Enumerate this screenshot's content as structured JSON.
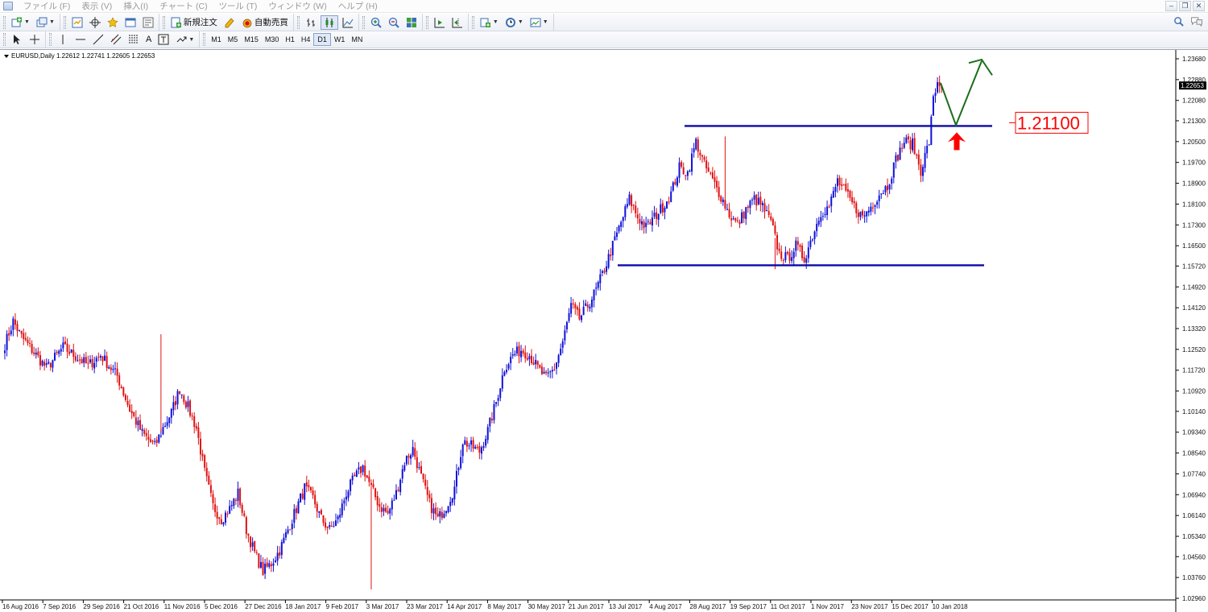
{
  "menubar": {
    "items": [
      "ファイル (F)",
      "表示 (V)",
      "挿入(I)",
      "チャート (C)",
      "ツール (T)",
      "ウィンドウ (W)",
      "ヘルプ (H)"
    ]
  },
  "toolbar": {
    "new_order": "新規注文",
    "auto_trade": "自動売買",
    "timeframes": [
      "M1",
      "M5",
      "M15",
      "M30",
      "H1",
      "H4",
      "D1",
      "W1",
      "MN"
    ],
    "active_timeframe": "D1",
    "text_tool": "A"
  },
  "chart": {
    "title": "EURUSD,Daily  1.22612 1.22741 1.22605 1.22653",
    "current_price_label": "1.22653",
    "level_label": "1.21100"
  },
  "chart_data": {
    "type": "candlestick",
    "symbol": "EURUSD",
    "timeframe": "Daily",
    "ohlc_header": {
      "open": 1.22612,
      "high": 1.22741,
      "low": 1.22605,
      "close": 1.22653
    },
    "y_ticks": [
      1.2368,
      1.2288,
      1.2208,
      1.213,
      1.205,
      1.197,
      1.189,
      1.181,
      1.173,
      1.165,
      1.1572,
      1.1492,
      1.1412,
      1.1332,
      1.1252,
      1.1172,
      1.1092,
      1.1014,
      1.0934,
      1.0854,
      1.0774,
      1.0694,
      1.0614,
      1.0534,
      1.0456,
      1.0376,
      1.0296
    ],
    "ylim": [
      1.0296,
      1.2368
    ],
    "x_tick_labels": [
      "16 Aug 2016",
      "7 Sep 2016",
      "29 Sep 2016",
      "21 Oct 2016",
      "11 Nov 2016",
      "5 Dec 2016",
      "27 Dec 2016",
      "18 Jan 2017",
      "9 Feb 2017",
      "3 Mar 2017",
      "23 Mar 2017",
      "14 Apr 2017",
      "8 May 2017",
      "30 May 2017",
      "21 Jun 2017",
      "13 Jul 2017",
      "4 Aug 2017",
      "28 Aug 2017",
      "19 Sep 2017",
      "11 Oct 2017",
      "1 Nov 2017",
      "23 Nov 2017",
      "15 Dec 2017",
      "10 Jan 2018"
    ],
    "price_path": [
      [
        0,
        1.127
      ],
      [
        4,
        1.136
      ],
      [
        8,
        1.13
      ],
      [
        14,
        1.124
      ],
      [
        20,
        1.118
      ],
      [
        28,
        1.126
      ],
      [
        40,
        1.119
      ],
      [
        46,
        1.123
      ],
      [
        54,
        1.115
      ],
      [
        60,
        1.102
      ],
      [
        66,
        1.093
      ],
      [
        72,
        1.088
      ],
      [
        76,
        1.095
      ],
      [
        80,
        1.101
      ],
      [
        84,
        1.11
      ],
      [
        88,
        1.103
      ],
      [
        92,
        1.095
      ],
      [
        96,
        1.078
      ],
      [
        100,
        1.065
      ],
      [
        104,
        1.06
      ],
      [
        108,
        1.064
      ],
      [
        112,
        1.07
      ],
      [
        116,
        1.056
      ],
      [
        120,
        1.047
      ],
      [
        124,
        1.04
      ],
      [
        128,
        1.043
      ],
      [
        132,
        1.048
      ],
      [
        136,
        1.056
      ],
      [
        140,
        1.064
      ],
      [
        144,
        1.072
      ],
      [
        148,
        1.068
      ],
      [
        152,
        1.06
      ],
      [
        156,
        1.056
      ],
      [
        160,
        1.06
      ],
      [
        164,
        1.07
      ],
      [
        168,
        1.076
      ],
      [
        172,
        1.08
      ],
      [
        176,
        1.072
      ],
      [
        180,
        1.065
      ],
      [
        184,
        1.062
      ],
      [
        188,
        1.07
      ],
      [
        192,
        1.082
      ],
      [
        196,
        1.087
      ],
      [
        200,
        1.076
      ],
      [
        204,
        1.066
      ],
      [
        208,
        1.06
      ],
      [
        212,
        1.065
      ],
      [
        216,
        1.072
      ],
      [
        220,
        1.09
      ],
      [
        224,
        1.088
      ],
      [
        228,
        1.086
      ],
      [
        232,
        1.094
      ],
      [
        236,
        1.105
      ],
      [
        240,
        1.118
      ],
      [
        244,
        1.123
      ],
      [
        248,
        1.125
      ],
      [
        252,
        1.123
      ],
      [
        256,
        1.118
      ],
      [
        260,
        1.114
      ],
      [
        264,
        1.118
      ],
      [
        268,
        1.128
      ],
      [
        272,
        1.142
      ],
      [
        276,
        1.137
      ],
      [
        280,
        1.142
      ],
      [
        284,
        1.148
      ],
      [
        288,
        1.156
      ],
      [
        292,
        1.165
      ],
      [
        296,
        1.174
      ],
      [
        300,
        1.183
      ],
      [
        304,
        1.176
      ],
      [
        308,
        1.172
      ],
      [
        312,
        1.176
      ],
      [
        316,
        1.18
      ],
      [
        320,
        1.185
      ],
      [
        324,
        1.195
      ],
      [
        328,
        1.193
      ],
      [
        332,
        1.205
      ],
      [
        336,
        1.196
      ],
      [
        340,
        1.19
      ],
      [
        344,
        1.184
      ],
      [
        348,
        1.177
      ],
      [
        352,
        1.173
      ],
      [
        356,
        1.179
      ],
      [
        360,
        1.183
      ],
      [
        364,
        1.18
      ],
      [
        368,
        1.174
      ],
      [
        372,
        1.162
      ],
      [
        376,
        1.16
      ],
      [
        380,
        1.165
      ],
      [
        384,
        1.16
      ],
      [
        388,
        1.169
      ],
      [
        392,
        1.178
      ],
      [
        396,
        1.18
      ],
      [
        400,
        1.19
      ],
      [
        404,
        1.185
      ],
      [
        408,
        1.18
      ],
      [
        412,
        1.176
      ],
      [
        416,
        1.18
      ],
      [
        420,
        1.185
      ],
      [
        424,
        1.188
      ],
      [
        428,
        1.198
      ],
      [
        432,
        1.205
      ],
      [
        436,
        1.204
      ],
      [
        440,
        1.194
      ],
      [
        444,
        1.205
      ],
      [
        446,
        1.221
      ],
      [
        448,
        1.228
      ],
      [
        450,
        1.2265
      ]
    ],
    "horizontal_lines": [
      {
        "price": 1.211,
        "color": "#0a0aa8",
        "label": "1.21100"
      },
      {
        "price": 1.1575,
        "color": "#0a0aa8"
      }
    ],
    "annotations": {
      "projection_arrow_color": "#1a6e1a",
      "up_arrow_color": "#ff0000",
      "label_color": "#ff0000"
    },
    "colors": {
      "bull": "#1010d8",
      "bear": "#e01010",
      "axis_text": "#111111"
    }
  }
}
